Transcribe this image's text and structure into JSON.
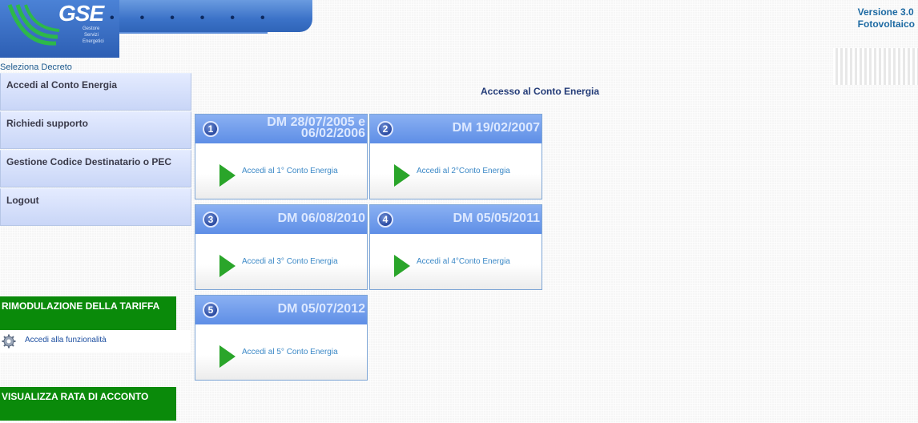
{
  "header": {
    "logo_text": "GSE",
    "logo_subtitle": [
      "Gestore",
      "Servizi",
      "Energetici"
    ],
    "version_line1": "Versione 3.0",
    "version_line2": "Fotovoltaico"
  },
  "sidebar": {
    "section_label": "Seleziona Decreto",
    "items": [
      {
        "label": "Accedi al Conto Energia"
      },
      {
        "label": "Richiedi supporto"
      },
      {
        "label": "Gestione Codice Destinatario o PEC"
      },
      {
        "label": "Logout"
      }
    ],
    "rimodulazione": {
      "title": "RIMODULAZIONE DELLA TARIFFA",
      "link_label": "Accedi alla funzionalità"
    },
    "rata": {
      "title": "VISUALIZZA RATA DI ACCONTO"
    }
  },
  "main": {
    "title": "Accesso al Conto Energia",
    "cards": [
      {
        "number": "1",
        "title_line1": "DM 28/07/2005 e",
        "title_line2": "06/02/2006",
        "link": "Accedi al 1° Conto Energia"
      },
      {
        "number": "2",
        "title_line1": "DM 19/02/2007",
        "title_line2": "",
        "link": "Accedi al 2°Conto Energia"
      },
      {
        "number": "3",
        "title_line1": "DM 06/08/2010",
        "title_line2": "",
        "link": "Accedi al 3° Conto Energia"
      },
      {
        "number": "4",
        "title_line1": "DM 05/05/2011",
        "title_line2": "",
        "link": "Accedi al 4°Conto Energia"
      },
      {
        "number": "5",
        "title_line1": "DM 05/07/2012",
        "title_line2": "",
        "link": "Accedi al 5° Conto Energia"
      }
    ]
  },
  "colors": {
    "menu_bg": "#c9d6f7",
    "green_section": "#0a8a0a",
    "card_header": "#5e8ee6",
    "play_icon": "#2aa52a",
    "link": "#3b88c6"
  }
}
